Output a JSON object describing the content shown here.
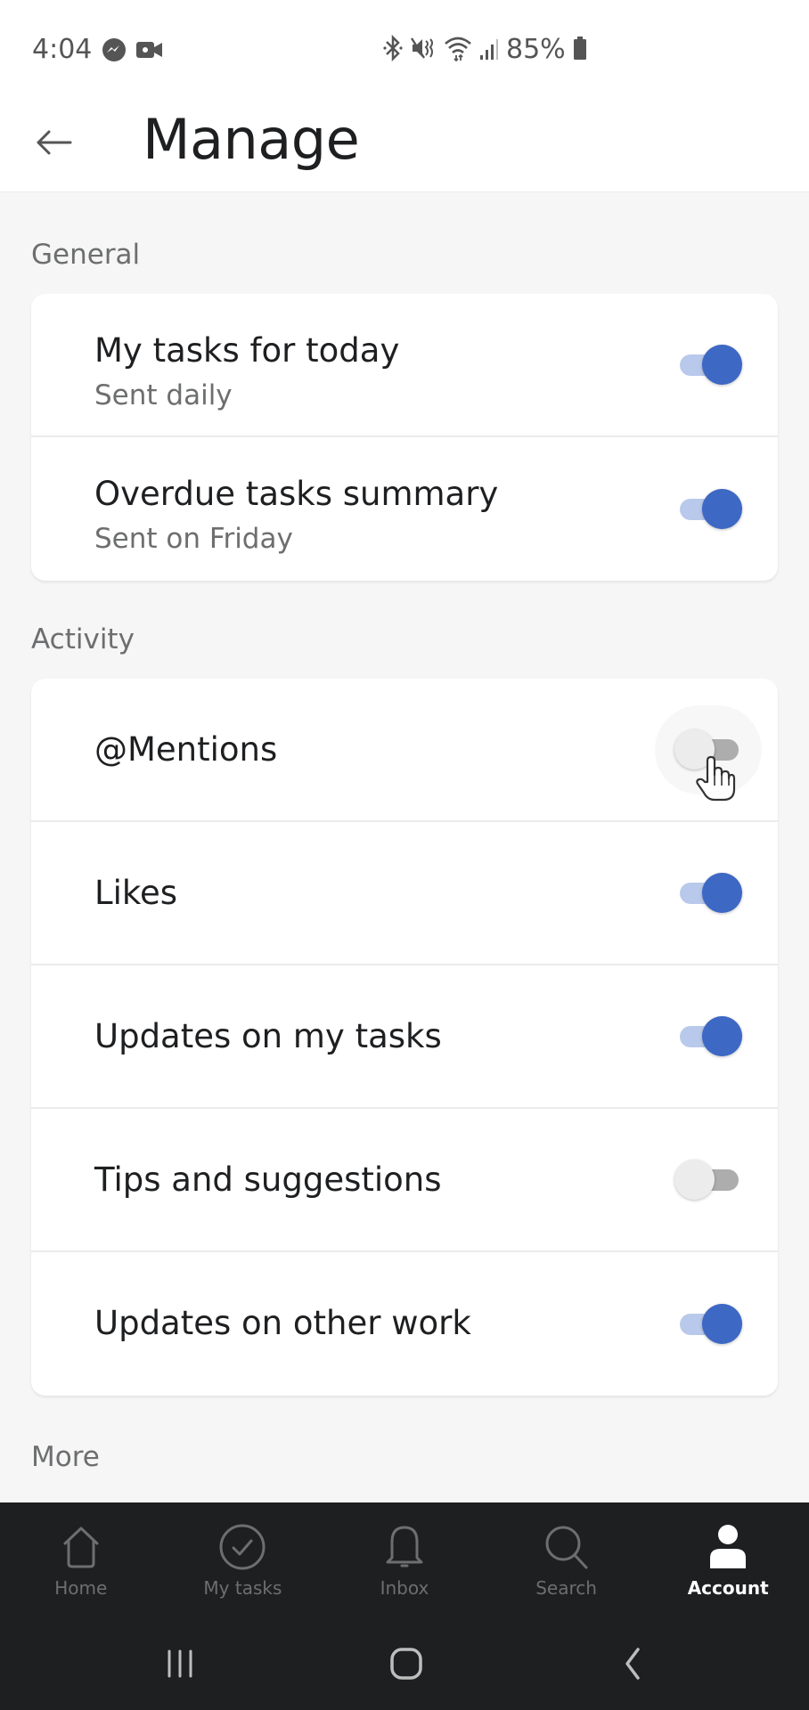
{
  "status_bar": {
    "time": "4:04",
    "left_icons": [
      "messenger-icon",
      "video-camera-icon"
    ],
    "right_icons": [
      "bluetooth-icon",
      "mute-vibrate-icon",
      "wifi-icon",
      "signal-icon",
      "battery-icon"
    ],
    "battery_percent": "85%"
  },
  "app_bar": {
    "back_icon": "arrow-left-icon",
    "title": "Manage"
  },
  "sections": [
    {
      "label": "General",
      "items": [
        {
          "title": "My tasks for today",
          "subtitle": "Sent daily",
          "enabled": true
        },
        {
          "title": "Overdue tasks summary",
          "subtitle": "Sent on Friday",
          "enabled": true
        }
      ]
    },
    {
      "label": "Activity",
      "items": [
        {
          "title": "@Mentions",
          "enabled": false
        },
        {
          "title": "Likes",
          "enabled": true
        },
        {
          "title": "Updates on my tasks",
          "enabled": true
        },
        {
          "title": "Tips and suggestions",
          "enabled": false
        },
        {
          "title": "Updates on other work",
          "enabled": true
        }
      ]
    },
    {
      "label": "More",
      "items": []
    }
  ],
  "tab_bar": {
    "active": "Account",
    "tabs": [
      {
        "label": "Home",
        "icon": "home-icon"
      },
      {
        "label": "My tasks",
        "icon": "check-circle-icon"
      },
      {
        "label": "Inbox",
        "icon": "bell-icon"
      },
      {
        "label": "Search",
        "icon": "search-icon"
      },
      {
        "label": "Account",
        "icon": "person-icon"
      }
    ]
  },
  "system_nav": [
    "recents-icon",
    "home-icon",
    "back-icon"
  ],
  "colors": {
    "accent": "#3d68c4",
    "accent_track": "#b9c9ec",
    "off_track": "#adadad",
    "off_knob": "#ececec",
    "tabbar_bg": "#1e1f21"
  }
}
